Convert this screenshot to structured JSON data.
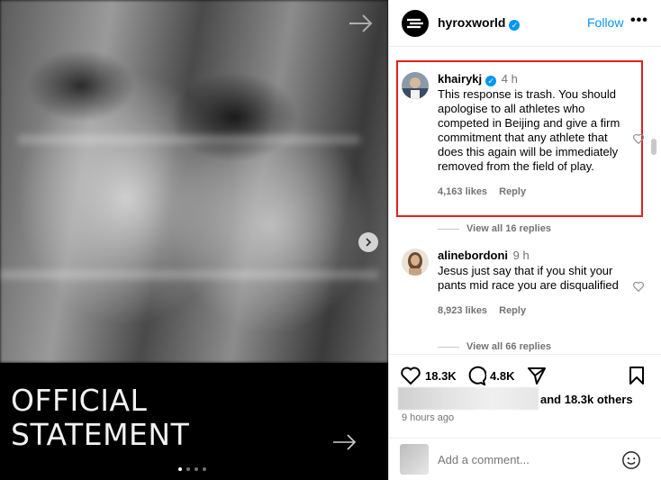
{
  "media": {
    "statement_line1": "OFFICIAL",
    "statement_line2": "STATEMENT",
    "carousel_pages": 4,
    "carousel_active": 1
  },
  "header": {
    "username": "hyroxworld",
    "follow_label": "Follow",
    "more_label": "•••"
  },
  "comments": [
    {
      "username": "khairykj",
      "verified": true,
      "time": "4 h",
      "text": "This response is trash. You should apologise to all athletes who competed in Beijing and give a firm commitment that any athlete that does this again will be immediately removed from the field of play.",
      "likes": "4,163 likes",
      "reply_label": "Reply",
      "view_replies": "View all 16 replies"
    },
    {
      "username": "alinebordoni",
      "verified": false,
      "time": "9 h",
      "text": "Jesus just say that if you shit your pants mid race you are disqualified",
      "likes": "8,923 likes",
      "reply_label": "Reply",
      "view_replies": "View all 66 replies"
    }
  ],
  "actions": {
    "like_count": "18.3K",
    "comment_count": "4.8K",
    "liked_by": "and 18.3k others",
    "posted_time": "9 hours ago"
  },
  "composer": {
    "placeholder": "Add a comment..."
  },
  "colors": {
    "accent": "#0095f6",
    "highlight": "#e02020",
    "muted": "#737373"
  }
}
